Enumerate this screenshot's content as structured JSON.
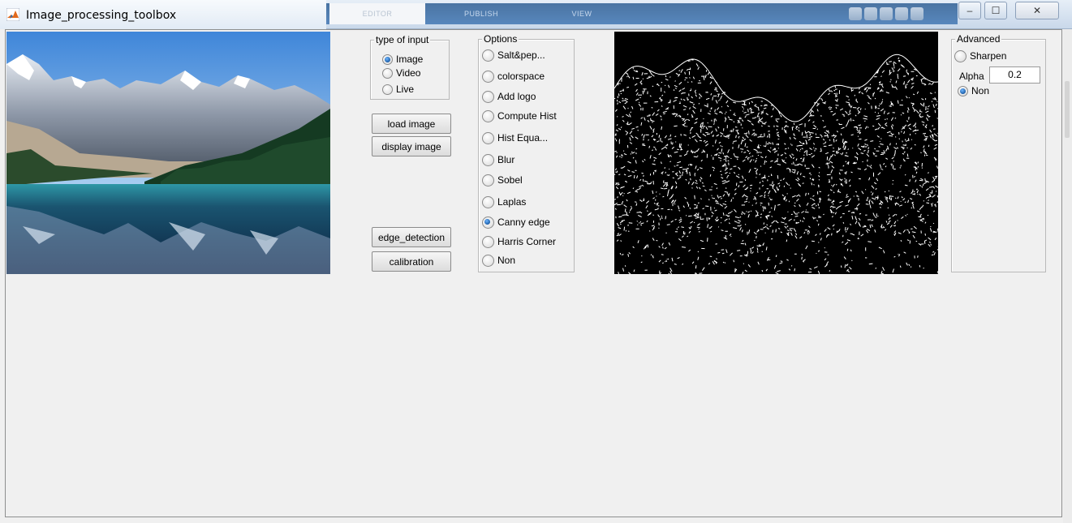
{
  "window": {
    "title": "Image_processing_toolbox",
    "app_icon": "matlab-icon",
    "ribbon_tabs": [
      "EDITOR",
      "PUBLISH",
      "VIEW"
    ],
    "controls": {
      "minimize": "–",
      "maximize": "☐",
      "close": "✕"
    }
  },
  "input_panel": {
    "title": "type of input",
    "options": [
      {
        "label": "Image",
        "checked": true
      },
      {
        "label": "Video",
        "checked": false
      },
      {
        "label": "Live",
        "checked": false
      }
    ]
  },
  "buttons": {
    "load": "load image",
    "display": "display image",
    "edge": "edge_detection",
    "calibration": "calibration"
  },
  "options_panel": {
    "title": "Options",
    "items": [
      {
        "label": "Salt&pep...",
        "checked": false
      },
      {
        "label": "colorspace",
        "checked": false
      },
      {
        "label": "Add logo",
        "checked": false
      },
      {
        "label": "Compute Hist",
        "checked": false
      },
      {
        "label": "Hist Equa...",
        "checked": false
      },
      {
        "label": "Blur",
        "checked": false
      },
      {
        "label": "Sobel",
        "checked": false
      },
      {
        "label": "Laplas",
        "checked": false
      },
      {
        "label": "Canny edge",
        "checked": true
      },
      {
        "label": "Harris Corner",
        "checked": false
      },
      {
        "label": "Non",
        "checked": false
      }
    ]
  },
  "advanced_panel": {
    "title": "Advanced",
    "sharpen_label": "Sharpen",
    "sharpen_checked": false,
    "alpha_label": "Alpha",
    "alpha_value": "0.2",
    "non_label": "Non",
    "non_checked": true
  },
  "colors": {
    "window_bg": "#f0f0f0",
    "radio_selected": "#1c5ea8",
    "edge_bg": "#000000",
    "edge_fg": "#ffffff"
  }
}
